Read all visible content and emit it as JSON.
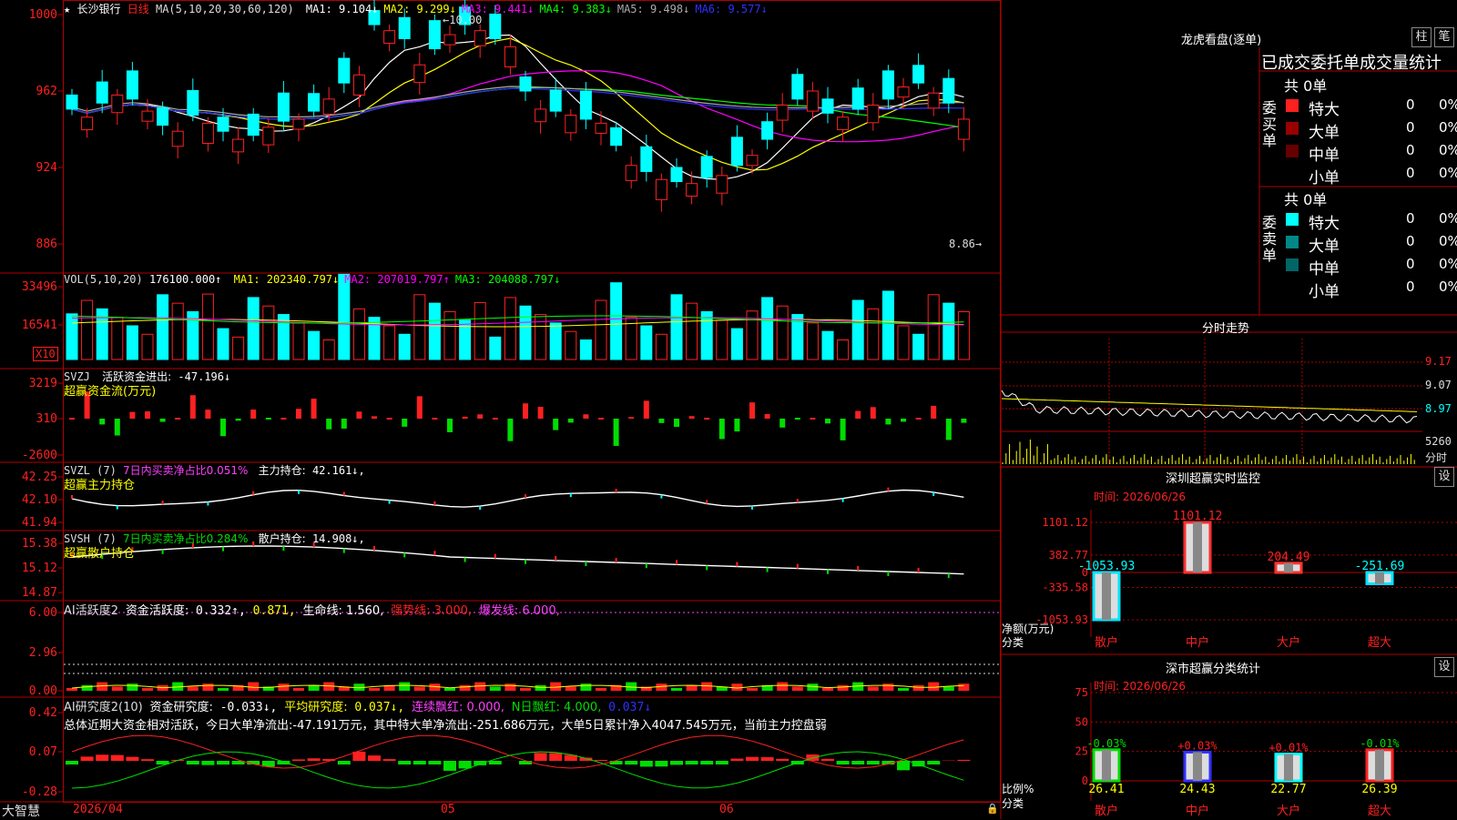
{
  "colors": {
    "up": "#ff2020",
    "down": "#00ffff",
    "grid": "#b00000",
    "ma1": "#ffffff",
    "ma2": "#ffff00",
    "ma3": "#ff00ff",
    "ma4": "#00ff00",
    "ma5": "#aaaaaa",
    "ma6": "#3030ff",
    "green": "#00dd00",
    "magenta": "#ff40ff",
    "yellow": "#ffff00"
  },
  "main": {
    "star": "★",
    "stock": "长沙银行",
    "period": "日线",
    "ma_label": "MA(5,10,20,30,60,120)",
    "ma": [
      {
        "name": "MA1:",
        "value": "9.104↓",
        "color": "#ffffff"
      },
      {
        "name": "MA2:",
        "value": "9.299↓",
        "color": "#ffff00"
      },
      {
        "name": "MA3:",
        "value": "9.441↓",
        "color": "#ff00ff"
      },
      {
        "name": "MA4:",
        "value": "9.383↓",
        "color": "#00ff00"
      },
      {
        "name": "MA5:",
        "value": "9.498↓",
        "color": "#aaaaaa"
      },
      {
        "name": "MA6:",
        "value": "9.577↓",
        "color": "#3030ff"
      }
    ],
    "y_ticks": [
      "1000",
      "962",
      "924",
      "886"
    ],
    "high_label": "10.00",
    "low_label": "8.86"
  },
  "vol": {
    "label": "VOL(5,10,20)",
    "value": "176100.000↑",
    "ma": [
      {
        "name": "MA1:",
        "value": "202340.797↓",
        "color": "#ffff00"
      },
      {
        "name": "MA2:",
        "value": "207019.797↑",
        "color": "#ff00ff"
      },
      {
        "name": "MA3:",
        "value": "204088.797↓",
        "color": "#00ff00"
      }
    ],
    "y_ticks": [
      "33496",
      "16541"
    ],
    "unit": "X10"
  },
  "svzj": {
    "label": "SVZJ",
    "item": "活跃资金进出:",
    "value": "-47.196↓",
    "subtitle": "超赢资金流(万元)",
    "y_ticks": [
      "3219",
      "310",
      "-2600"
    ]
  },
  "svzl": {
    "label": "SVZL (7)",
    "ratio": "7日内买卖净占比0.051%",
    "item": "主力持仓:",
    "value": "42.161↓,",
    "subtitle": "超赢主力持仓",
    "y_ticks": [
      "42.25",
      "42.10",
      "41.94"
    ]
  },
  "svsh": {
    "label": "SVSH (7)",
    "ratio": "7日内买卖净占比0.284%",
    "item": "散户持仓:",
    "value": "14.908↓,",
    "subtitle": "超赢散户持仓",
    "y_ticks": [
      "15.38",
      "15.12",
      "14.87"
    ]
  },
  "ai1": {
    "label": "AI活跃度2",
    "item": "资金活跃度:",
    "v1": "0.332↑,",
    "v2": "0.871,",
    "life": "生命线: 1.560,",
    "strong": "强势线: 3.000,",
    "burst": "爆发线: 6.000,",
    "y_ticks": [
      "6.00",
      "2.96",
      "0.00"
    ]
  },
  "ai2": {
    "label": "AI研究度2(10)",
    "item": "资金研究度:",
    "v1": "-0.033↓,",
    "avg": "平均研究度:",
    "v2": "0.037↓,",
    "red": "连续飘红: 0.000,",
    "nred": "N日飘红: 4.000,",
    "v3": "0.037↓",
    "summary": "总体近期大资金相对活跃，今日大单净流出:-47.191万元，其中特大单净流出:-251.686万元，大单5日累计净入4047.545万元，当前主力控盘弱",
    "y_ticks": [
      "0.42",
      "0.07",
      "-0.28"
    ]
  },
  "dates": {
    "d1": "2026/04",
    "d2": "05",
    "d3": "06"
  },
  "brand": "大智慧",
  "dragon": {
    "title": "龙虎看盘(逐单)",
    "btn1": "柱",
    "btn2": "笔",
    "subtitle": "已成交委托单成交量统计",
    "buy_side": "委买单",
    "sell_side": "委卖单",
    "buy_total": "共 0单",
    "sell_total": "共 0单",
    "buy_rows": [
      {
        "label": "特大",
        "v": "0",
        "p": "0%",
        "color": "#ff2020"
      },
      {
        "label": "大单",
        "v": "0",
        "p": "0%",
        "color": "#990000"
      },
      {
        "label": "中单",
        "v": "0",
        "p": "0%",
        "color": "#660000"
      },
      {
        "label": "小单",
        "v": "0",
        "p": "0%",
        "color": ""
      }
    ],
    "sell_rows": [
      {
        "label": "特大",
        "v": "0",
        "p": "0%",
        "color": "#00ffff"
      },
      {
        "label": "大单",
        "v": "0",
        "p": "0%",
        "color": "#008888"
      },
      {
        "label": "中单",
        "v": "0",
        "p": "0%",
        "color": "#006666"
      },
      {
        "label": "小单",
        "v": "0",
        "p": "0%",
        "color": ""
      }
    ]
  },
  "intraday": {
    "title": "分时走势",
    "y_ticks": [
      "9.17",
      "9.07",
      "8.97"
    ],
    "vol_tick": "5260",
    "vol_label": "分时"
  },
  "sz_monitor": {
    "title": "深圳超赢实时监控",
    "btn": "设",
    "time": "时间: 2026/06/26",
    "y_ticks": [
      "1101.12",
      "382.77",
      "0",
      "-335.58",
      "-1053.93"
    ],
    "ylabel": "净额(万元)",
    "xlabel": "分类",
    "categories": [
      "散户",
      "中户",
      "大户",
      "超大"
    ],
    "values": [
      -1053.93,
      1101.12,
      204.49,
      -251.69
    ],
    "value_labels": [
      "-1053.93",
      "1101.12",
      "204.49",
      "-251.69"
    ]
  },
  "sz_stats": {
    "title": "深市超赢分类统计",
    "btn": "设",
    "time": "时间: 2026/06/26",
    "y_ticks": [
      "75",
      "50",
      "25",
      "0"
    ],
    "ylabel": "比例%",
    "xlabel": "分类",
    "categories": [
      "散户",
      "中户",
      "大户",
      "超大"
    ],
    "values": [
      26.41,
      24.43,
      22.77,
      26.39
    ],
    "changes": [
      "-0.03%",
      "+0.03%",
      "+0.01%",
      "-0.01%"
    ],
    "value_labels": [
      "26.41",
      "24.43",
      "22.77",
      "26.39"
    ]
  }
}
